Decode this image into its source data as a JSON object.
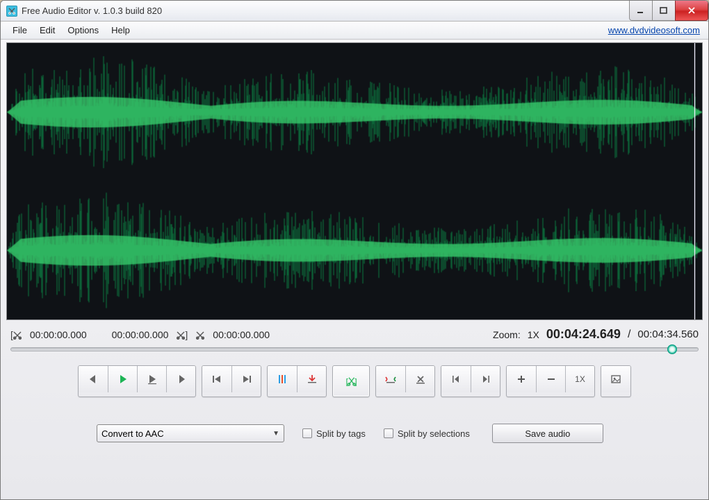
{
  "window": {
    "title": "Free Audio Editor v. 1.0.3 build 820"
  },
  "menu": {
    "items": [
      "File",
      "Edit",
      "Options",
      "Help"
    ],
    "url": "www.dvdvideosoft.com"
  },
  "selection": {
    "start": "00:00:00.000",
    "end": "00:00:00.000",
    "cursor": "00:00:00.000"
  },
  "zoom": {
    "label": "Zoom:",
    "value": "1X"
  },
  "position": "00:04:24.649",
  "duration": "00:04:34.560",
  "seek_percent": 96.3,
  "toolbar": {
    "zoom_btn_label": "1X"
  },
  "bottom": {
    "convert_label": "Convert to AAC",
    "split_tags_label": "Split by tags",
    "split_sel_label": "Split by selections",
    "save_label": "Save audio"
  },
  "colors": {
    "wave_outer": "#0d7f42",
    "wave_inner": "#3bcf6e",
    "play_green": "#1db455",
    "accent_teal": "#17b898",
    "bg_dark": "#0f1216"
  }
}
